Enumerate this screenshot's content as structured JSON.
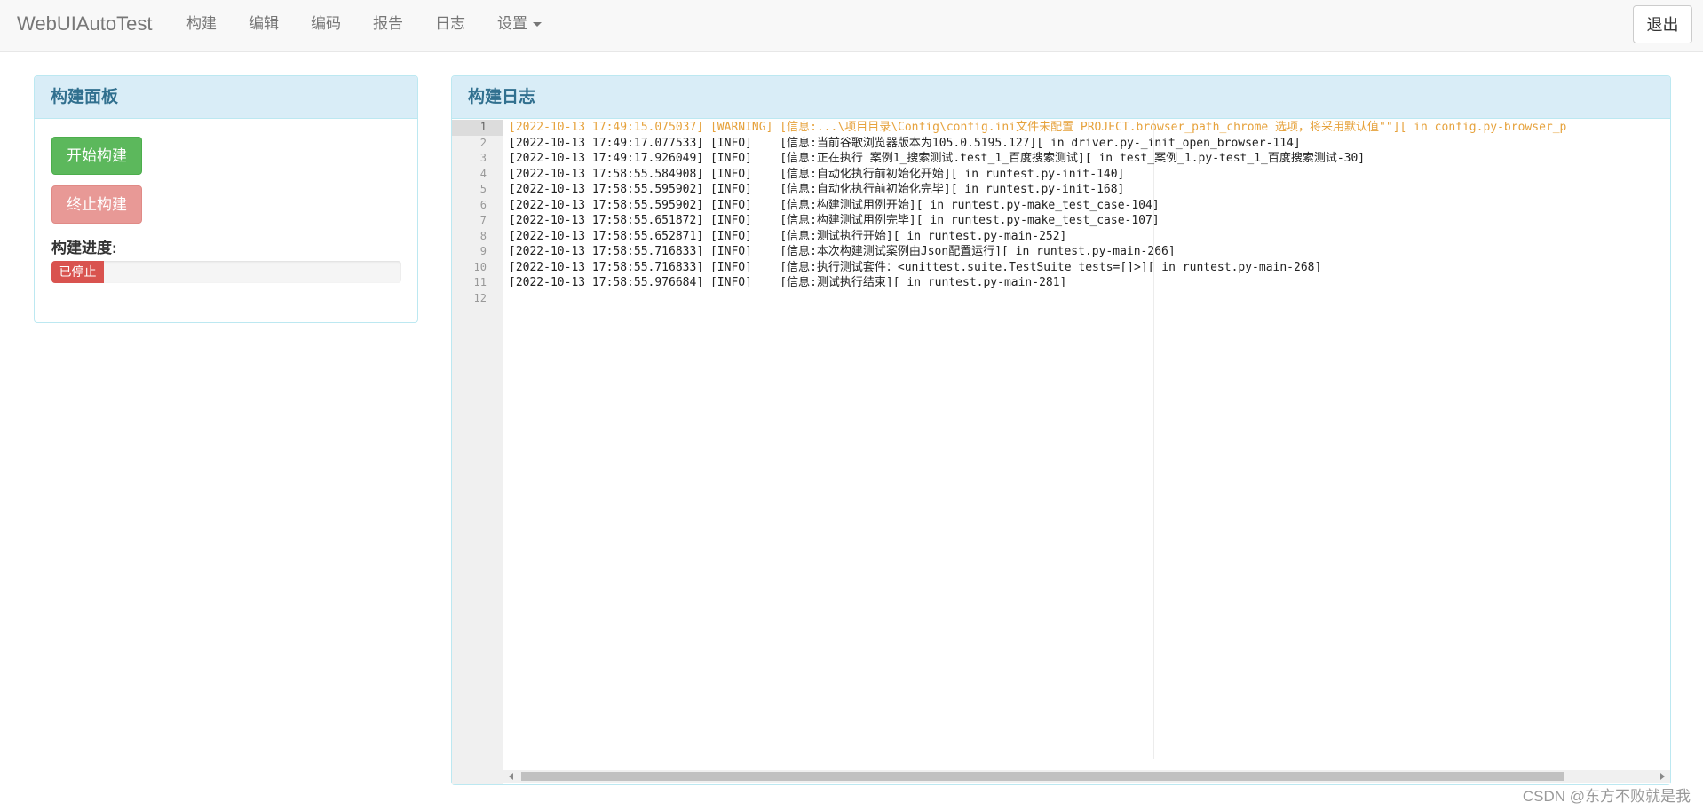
{
  "navbar": {
    "brand": "WebUIAutoTest",
    "items": [
      {
        "label": "构建"
      },
      {
        "label": "编辑"
      },
      {
        "label": "编码"
      },
      {
        "label": "报告"
      },
      {
        "label": "日志"
      },
      {
        "label": "设置"
      }
    ],
    "logout_label": "退出"
  },
  "build_panel": {
    "title": "构建面板",
    "start_label": "开始构建",
    "stop_label": "终止构建",
    "progress_label": "构建进度:",
    "progress_status": "已停止",
    "progress_fraction": 0.15
  },
  "log_panel": {
    "title": "构建日志",
    "line_numbers": [
      "1",
      "2",
      "3",
      "4",
      "5",
      "6",
      "7",
      "8",
      "9",
      "10",
      "11",
      "12"
    ],
    "lines": [
      "[2022-10-13 17:49:15.075037] [WARNING] [信息:...\\项目目录\\Config\\config.ini文件未配置 PROJECT.browser_path_chrome 选项，将采用默认值\"\"][ in config.py-browser_p",
      "[2022-10-13 17:49:17.077533] [INFO]    [信息:当前谷歌浏览器版本为105.0.5195.127][ in driver.py-_init_open_browser-114]",
      "[2022-10-13 17:49:17.926049] [INFO]    [信息:正在执行 案例1_搜索测试.test_1_百度搜索测试][ in test_案例_1.py-test_1_百度搜索测试-30]",
      "[2022-10-13 17:58:55.584908] [INFO]    [信息:自动化执行前初始化开始][ in runtest.py-init-140]",
      "[2022-10-13 17:58:55.595902] [INFO]    [信息:自动化执行前初始化完毕][ in runtest.py-init-168]",
      "[2022-10-13 17:58:55.595902] [INFO]    [信息:构建测试用例开始][ in runtest.py-make_test_case-104]",
      "[2022-10-13 17:58:55.651872] [INFO]    [信息:构建测试用例完毕][ in runtest.py-make_test_case-107]",
      "[2022-10-13 17:58:55.652871] [INFO]    [信息:测试执行开始][ in runtest.py-main-252]",
      "[2022-10-13 17:58:55.716833] [INFO]    [信息:本次构建测试案例由Json配置运行][ in runtest.py-main-266]",
      "[2022-10-13 17:58:55.716833] [INFO]    [信息:执行测试套件：<unittest.suite.TestSuite tests=[]>][ in runtest.py-main-268]",
      "[2022-10-13 17:58:55.976684] [INFO]    [信息:测试执行结束][ in runtest.py-main-281]",
      ""
    ]
  },
  "watermark": "CSDN @东方不败就是我",
  "colors": {
    "start": "#5cb85c",
    "stop": "#e89996",
    "progress": "#d9534f",
    "panel_heading": "#d9edf7",
    "warning": "#e6a23c"
  },
  "icons": {
    "settings_dropdown": "caret-down-icon"
  }
}
